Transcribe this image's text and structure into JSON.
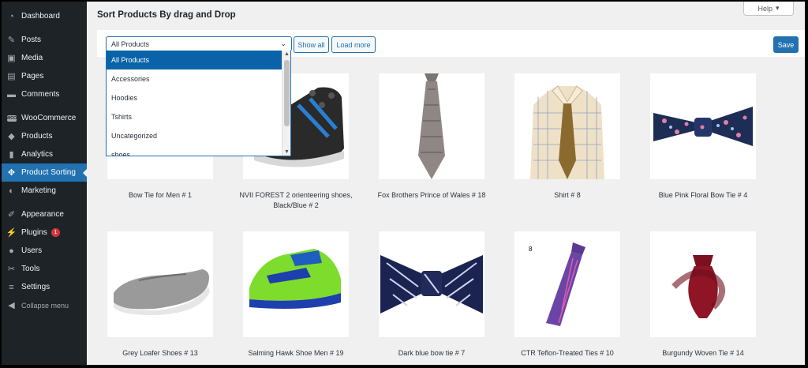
{
  "sidebar": {
    "items": [
      {
        "label": "Dashboard",
        "icon": "dashboard-icon",
        "glyph": "◔"
      },
      {
        "label": "Posts",
        "icon": "pin-icon",
        "glyph": "✎"
      },
      {
        "label": "Media",
        "icon": "media-icon",
        "glyph": "▣"
      },
      {
        "label": "Pages",
        "icon": "pages-icon",
        "glyph": "▤"
      },
      {
        "label": "Comments",
        "icon": "comment-icon",
        "glyph": "▬"
      },
      {
        "label": "WooCommerce",
        "icon": "woocommerce-icon",
        "glyph": "woo"
      },
      {
        "label": "Products",
        "icon": "box-icon",
        "glyph": "◆"
      },
      {
        "label": "Analytics",
        "icon": "bar-chart-icon",
        "glyph": "▮"
      },
      {
        "label": "Product Sorting",
        "icon": "move-arrows-icon",
        "glyph": "✥"
      },
      {
        "label": "Marketing",
        "icon": "megaphone-icon",
        "glyph": "◐"
      },
      {
        "label": "Appearance",
        "icon": "paintbrush-icon",
        "glyph": "✐"
      },
      {
        "label": "Plugins",
        "icon": "plug-icon",
        "glyph": "⚡"
      },
      {
        "label": "Users",
        "icon": "user-icon",
        "glyph": "●"
      },
      {
        "label": "Tools",
        "icon": "wrench-icon",
        "glyph": "✂"
      },
      {
        "label": "Settings",
        "icon": "sliders-icon",
        "glyph": "≡"
      }
    ],
    "plugins_badge": "1",
    "collapse_label": "Collapse menu",
    "active": "Product Sorting"
  },
  "header": {
    "title": "Sort Products By drag and Drop",
    "help_label": "Help"
  },
  "toolbar": {
    "selected_category": "All Products",
    "show_all_label": "Show all",
    "load_more_label": "Load more",
    "save_label": "Save"
  },
  "dropdown": {
    "options": [
      "All Products",
      "Accessories",
      "Hoodies",
      "Tshirts",
      "Uncategorized",
      "shoes"
    ]
  },
  "products": [
    {
      "name": "Bow Tie for Men # 1"
    },
    {
      "name": "NVII FOREST 2 orienteering shoes, Black/Blue # 2"
    },
    {
      "name": "Fox Brothers Prince of Wales # 18"
    },
    {
      "name": "Shirt # 8"
    },
    {
      "name": "Blue Pink Floral Bow Tie # 4"
    },
    {
      "name": "Grey Loafer Shoes # 13"
    },
    {
      "name": "Salming Hawk Shoe Men # 19"
    },
    {
      "name": "Dark blue bow tie # 7"
    },
    {
      "name": "CTR Teflon-Treated Ties # 10",
      "corner_label": "8"
    },
    {
      "name": "Burgundy Woven Tie # 14"
    }
  ],
  "colors": {
    "sidebar_bg": "#1d2327",
    "accent": "#2271b1",
    "page_bg": "#f0f0f1"
  }
}
